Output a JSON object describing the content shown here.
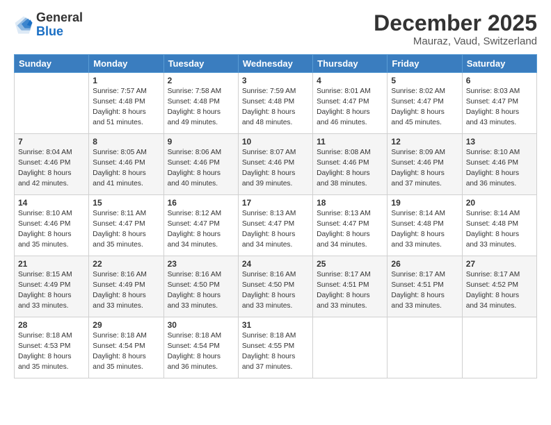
{
  "header": {
    "logo_general": "General",
    "logo_blue": "Blue",
    "title": "December 2025",
    "subtitle": "Mauraz, Vaud, Switzerland"
  },
  "weekdays": [
    "Sunday",
    "Monday",
    "Tuesday",
    "Wednesday",
    "Thursday",
    "Friday",
    "Saturday"
  ],
  "weeks": [
    [
      {
        "day": "",
        "info": ""
      },
      {
        "day": "1",
        "info": "Sunrise: 7:57 AM\nSunset: 4:48 PM\nDaylight: 8 hours\nand 51 minutes."
      },
      {
        "day": "2",
        "info": "Sunrise: 7:58 AM\nSunset: 4:48 PM\nDaylight: 8 hours\nand 49 minutes."
      },
      {
        "day": "3",
        "info": "Sunrise: 7:59 AM\nSunset: 4:48 PM\nDaylight: 8 hours\nand 48 minutes."
      },
      {
        "day": "4",
        "info": "Sunrise: 8:01 AM\nSunset: 4:47 PM\nDaylight: 8 hours\nand 46 minutes."
      },
      {
        "day": "5",
        "info": "Sunrise: 8:02 AM\nSunset: 4:47 PM\nDaylight: 8 hours\nand 45 minutes."
      },
      {
        "day": "6",
        "info": "Sunrise: 8:03 AM\nSunset: 4:47 PM\nDaylight: 8 hours\nand 43 minutes."
      }
    ],
    [
      {
        "day": "7",
        "info": "Sunrise: 8:04 AM\nSunset: 4:46 PM\nDaylight: 8 hours\nand 42 minutes."
      },
      {
        "day": "8",
        "info": "Sunrise: 8:05 AM\nSunset: 4:46 PM\nDaylight: 8 hours\nand 41 minutes."
      },
      {
        "day": "9",
        "info": "Sunrise: 8:06 AM\nSunset: 4:46 PM\nDaylight: 8 hours\nand 40 minutes."
      },
      {
        "day": "10",
        "info": "Sunrise: 8:07 AM\nSunset: 4:46 PM\nDaylight: 8 hours\nand 39 minutes."
      },
      {
        "day": "11",
        "info": "Sunrise: 8:08 AM\nSunset: 4:46 PM\nDaylight: 8 hours\nand 38 minutes."
      },
      {
        "day": "12",
        "info": "Sunrise: 8:09 AM\nSunset: 4:46 PM\nDaylight: 8 hours\nand 37 minutes."
      },
      {
        "day": "13",
        "info": "Sunrise: 8:10 AM\nSunset: 4:46 PM\nDaylight: 8 hours\nand 36 minutes."
      }
    ],
    [
      {
        "day": "14",
        "info": "Sunrise: 8:10 AM\nSunset: 4:46 PM\nDaylight: 8 hours\nand 35 minutes."
      },
      {
        "day": "15",
        "info": "Sunrise: 8:11 AM\nSunset: 4:47 PM\nDaylight: 8 hours\nand 35 minutes."
      },
      {
        "day": "16",
        "info": "Sunrise: 8:12 AM\nSunset: 4:47 PM\nDaylight: 8 hours\nand 34 minutes."
      },
      {
        "day": "17",
        "info": "Sunrise: 8:13 AM\nSunset: 4:47 PM\nDaylight: 8 hours\nand 34 minutes."
      },
      {
        "day": "18",
        "info": "Sunrise: 8:13 AM\nSunset: 4:47 PM\nDaylight: 8 hours\nand 34 minutes."
      },
      {
        "day": "19",
        "info": "Sunrise: 8:14 AM\nSunset: 4:48 PM\nDaylight: 8 hours\nand 33 minutes."
      },
      {
        "day": "20",
        "info": "Sunrise: 8:14 AM\nSunset: 4:48 PM\nDaylight: 8 hours\nand 33 minutes."
      }
    ],
    [
      {
        "day": "21",
        "info": "Sunrise: 8:15 AM\nSunset: 4:49 PM\nDaylight: 8 hours\nand 33 minutes."
      },
      {
        "day": "22",
        "info": "Sunrise: 8:16 AM\nSunset: 4:49 PM\nDaylight: 8 hours\nand 33 minutes."
      },
      {
        "day": "23",
        "info": "Sunrise: 8:16 AM\nSunset: 4:50 PM\nDaylight: 8 hours\nand 33 minutes."
      },
      {
        "day": "24",
        "info": "Sunrise: 8:16 AM\nSunset: 4:50 PM\nDaylight: 8 hours\nand 33 minutes."
      },
      {
        "day": "25",
        "info": "Sunrise: 8:17 AM\nSunset: 4:51 PM\nDaylight: 8 hours\nand 33 minutes."
      },
      {
        "day": "26",
        "info": "Sunrise: 8:17 AM\nSunset: 4:51 PM\nDaylight: 8 hours\nand 33 minutes."
      },
      {
        "day": "27",
        "info": "Sunrise: 8:17 AM\nSunset: 4:52 PM\nDaylight: 8 hours\nand 34 minutes."
      }
    ],
    [
      {
        "day": "28",
        "info": "Sunrise: 8:18 AM\nSunset: 4:53 PM\nDaylight: 8 hours\nand 35 minutes."
      },
      {
        "day": "29",
        "info": "Sunrise: 8:18 AM\nSunset: 4:54 PM\nDaylight: 8 hours\nand 35 minutes."
      },
      {
        "day": "30",
        "info": "Sunrise: 8:18 AM\nSunset: 4:54 PM\nDaylight: 8 hours\nand 36 minutes."
      },
      {
        "day": "31",
        "info": "Sunrise: 8:18 AM\nSunset: 4:55 PM\nDaylight: 8 hours\nand 37 minutes."
      },
      {
        "day": "",
        "info": ""
      },
      {
        "day": "",
        "info": ""
      },
      {
        "day": "",
        "info": ""
      }
    ]
  ],
  "gray_weeks": [
    1,
    3
  ]
}
